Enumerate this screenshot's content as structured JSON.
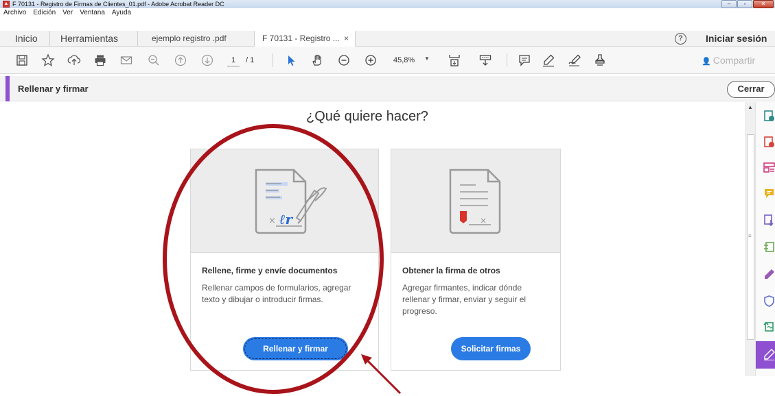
{
  "window": {
    "title": "F 70131 - Registro de Firmas de Clientes_01.pdf - Adobe Acrobat Reader DC",
    "controls": {
      "minimize": "–",
      "maximize": "▫",
      "close": "✕"
    }
  },
  "menu": [
    "Archivo",
    "Edición",
    "Ver",
    "Ventana",
    "Ayuda"
  ],
  "tabs": {
    "home": "Inicio",
    "tools": "Herramientas",
    "doc1": "ejemplo registro .pdf",
    "doc2": "F 70131 - Registro ...",
    "doc2_close": "×"
  },
  "header": {
    "help": "?",
    "signin": "Iniciar sesión"
  },
  "toolbar": {
    "page_current": "1",
    "page_total": "/ 1",
    "zoom": "45,8%",
    "share": "Compartir"
  },
  "tool_panel": {
    "title": "Rellenar y firmar",
    "close": "Cerrar"
  },
  "main": {
    "question": "¿Qué quiere hacer?",
    "cards": [
      {
        "title": "Rellene, firme y envíe documentos",
        "description": "Rellenar campos de formularios, agregar texto y dibujar o introducir firmas.",
        "button": "Rellenar y firmar"
      },
      {
        "title": "Obtener la firma de otros",
        "description": "Agregar firmantes, indicar dónde rellenar y firmar, enviar y seguir el progreso.",
        "button": "Solicitar firmas"
      }
    ]
  },
  "colors": {
    "accent_purple": "#8e4fd0",
    "button_blue": "#2b7be5",
    "annotation_red": "#a8141a"
  },
  "icons": {
    "toolbar": [
      "save-icon",
      "bookmark-star-icon",
      "upload-cloud-icon",
      "print-icon",
      "email-icon",
      "zoom-out-magnifier-icon",
      "page-up-icon",
      "page-down-icon",
      "select-arrow-icon",
      "hand-icon",
      "zoom-minus-icon",
      "zoom-plus-icon",
      "page-fit-icon",
      "scroll-mode-icon",
      "comment-icon",
      "highlight-pen-icon",
      "sign-icon",
      "stamp-icon"
    ],
    "rail": [
      "create-pdf-icon",
      "edit-pdf-icon",
      "organize-pages-icon",
      "comment-icon",
      "export-pdf-icon",
      "compress-icon",
      "fill-sign-icon",
      "protect-icon",
      "send-icon",
      "fill-sign-active-icon"
    ]
  }
}
